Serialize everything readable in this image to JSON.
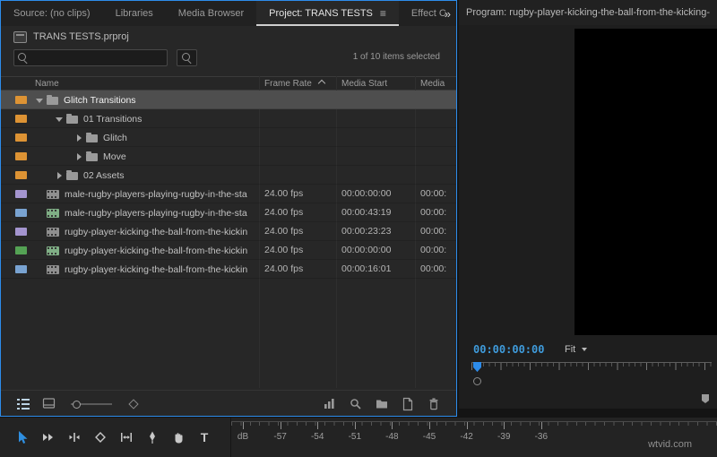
{
  "colors": {
    "accent_blue": "#2d8ceb",
    "label_orange": "#dd9334",
    "label_purple": "#a495cf",
    "label_blue": "#79a3d1",
    "label_green": "#54a254"
  },
  "tab_bar": {
    "tabs": [
      {
        "label": "Source: (no clips)",
        "active": false
      },
      {
        "label": "Libraries",
        "active": false
      },
      {
        "label": "Media Browser",
        "active": false
      },
      {
        "label": "Project: TRANS TESTS",
        "active": true
      },
      {
        "label": "Effect C",
        "active": false
      }
    ],
    "overflow_chevron": "»"
  },
  "project": {
    "file_name": "TRANS TESTS.prproj",
    "search_value": "",
    "selection_status": "1 of 10 items selected",
    "columns": {
      "name": "Name",
      "frame_rate": "Frame Rate",
      "media_start": "Media Start",
      "media": "Media"
    },
    "rows": [
      {
        "type": "bin",
        "name": "Glitch Transitions",
        "label_color": "orange",
        "indent": 0,
        "expanded": true,
        "icon": "folder",
        "selected": true,
        "fps": "",
        "start": "",
        "media": ""
      },
      {
        "type": "bin",
        "name": "01 Transitions",
        "label_color": "orange",
        "indent": 1,
        "expanded": true,
        "icon": "folder",
        "selected": false,
        "fps": "",
        "start": "",
        "media": ""
      },
      {
        "type": "bin",
        "name": "Glitch",
        "label_color": "orange",
        "indent": 2,
        "expanded": false,
        "icon": "folder",
        "selected": false,
        "fps": "",
        "start": "",
        "media": ""
      },
      {
        "type": "bin",
        "name": "Move",
        "label_color": "orange",
        "indent": 2,
        "expanded": false,
        "icon": "folder",
        "selected": false,
        "fps": "",
        "start": "",
        "media": ""
      },
      {
        "type": "bin",
        "name": "02 Assets",
        "label_color": "orange",
        "indent": 1,
        "expanded": false,
        "icon": "folder",
        "selected": false,
        "fps": "",
        "start": "",
        "media": ""
      },
      {
        "type": "clip",
        "name": "male-rugby-players-playing-rugby-in-the-sta",
        "label_color": "purple",
        "indent": 0,
        "expanded": null,
        "icon": "clip",
        "selected": false,
        "fps": "24.00 fps",
        "start": "00:00:00:00",
        "media": "00:00:"
      },
      {
        "type": "clip",
        "name": "male-rugby-players-playing-rugby-in-the-sta",
        "label_color": "blue",
        "indent": 0,
        "expanded": null,
        "icon": "clip-green",
        "selected": false,
        "fps": "24.00 fps",
        "start": "00:00:43:19",
        "media": "00:00:"
      },
      {
        "type": "clip",
        "name": "rugby-player-kicking-the-ball-from-the-kickin",
        "label_color": "purple",
        "indent": 0,
        "expanded": null,
        "icon": "clip",
        "selected": false,
        "fps": "24.00 fps",
        "start": "00:00:23:23",
        "media": "00:00:"
      },
      {
        "type": "clip",
        "name": "rugby-player-kicking-the-ball-from-the-kickin",
        "label_color": "green",
        "indent": 0,
        "expanded": null,
        "icon": "clip-green",
        "selected": false,
        "fps": "24.00 fps",
        "start": "00:00:00:00",
        "media": "00:00:"
      },
      {
        "type": "clip",
        "name": "rugby-player-kicking-the-ball-from-the-kickin",
        "label_color": "blue",
        "indent": 0,
        "expanded": null,
        "icon": "clip",
        "selected": false,
        "fps": "24.00 fps",
        "start": "00:00:16:01",
        "media": "00:00:"
      }
    ]
  },
  "program": {
    "title": "Program: rugby-player-kicking-the-ball-from-the-kicking-tee-o",
    "timecode": "00:00:00:00",
    "zoom_select": "Fit"
  },
  "tools": [
    "selection",
    "track-select-forward",
    "ripple-edit",
    "razor",
    "slip",
    "pen",
    "hand",
    "type"
  ],
  "audio_meter": {
    "labels": [
      "dB",
      "-57",
      "-54",
      "-51",
      "-48",
      "-45",
      "-42",
      "-39",
      "-36"
    ]
  },
  "watermark": "wtvid.com"
}
